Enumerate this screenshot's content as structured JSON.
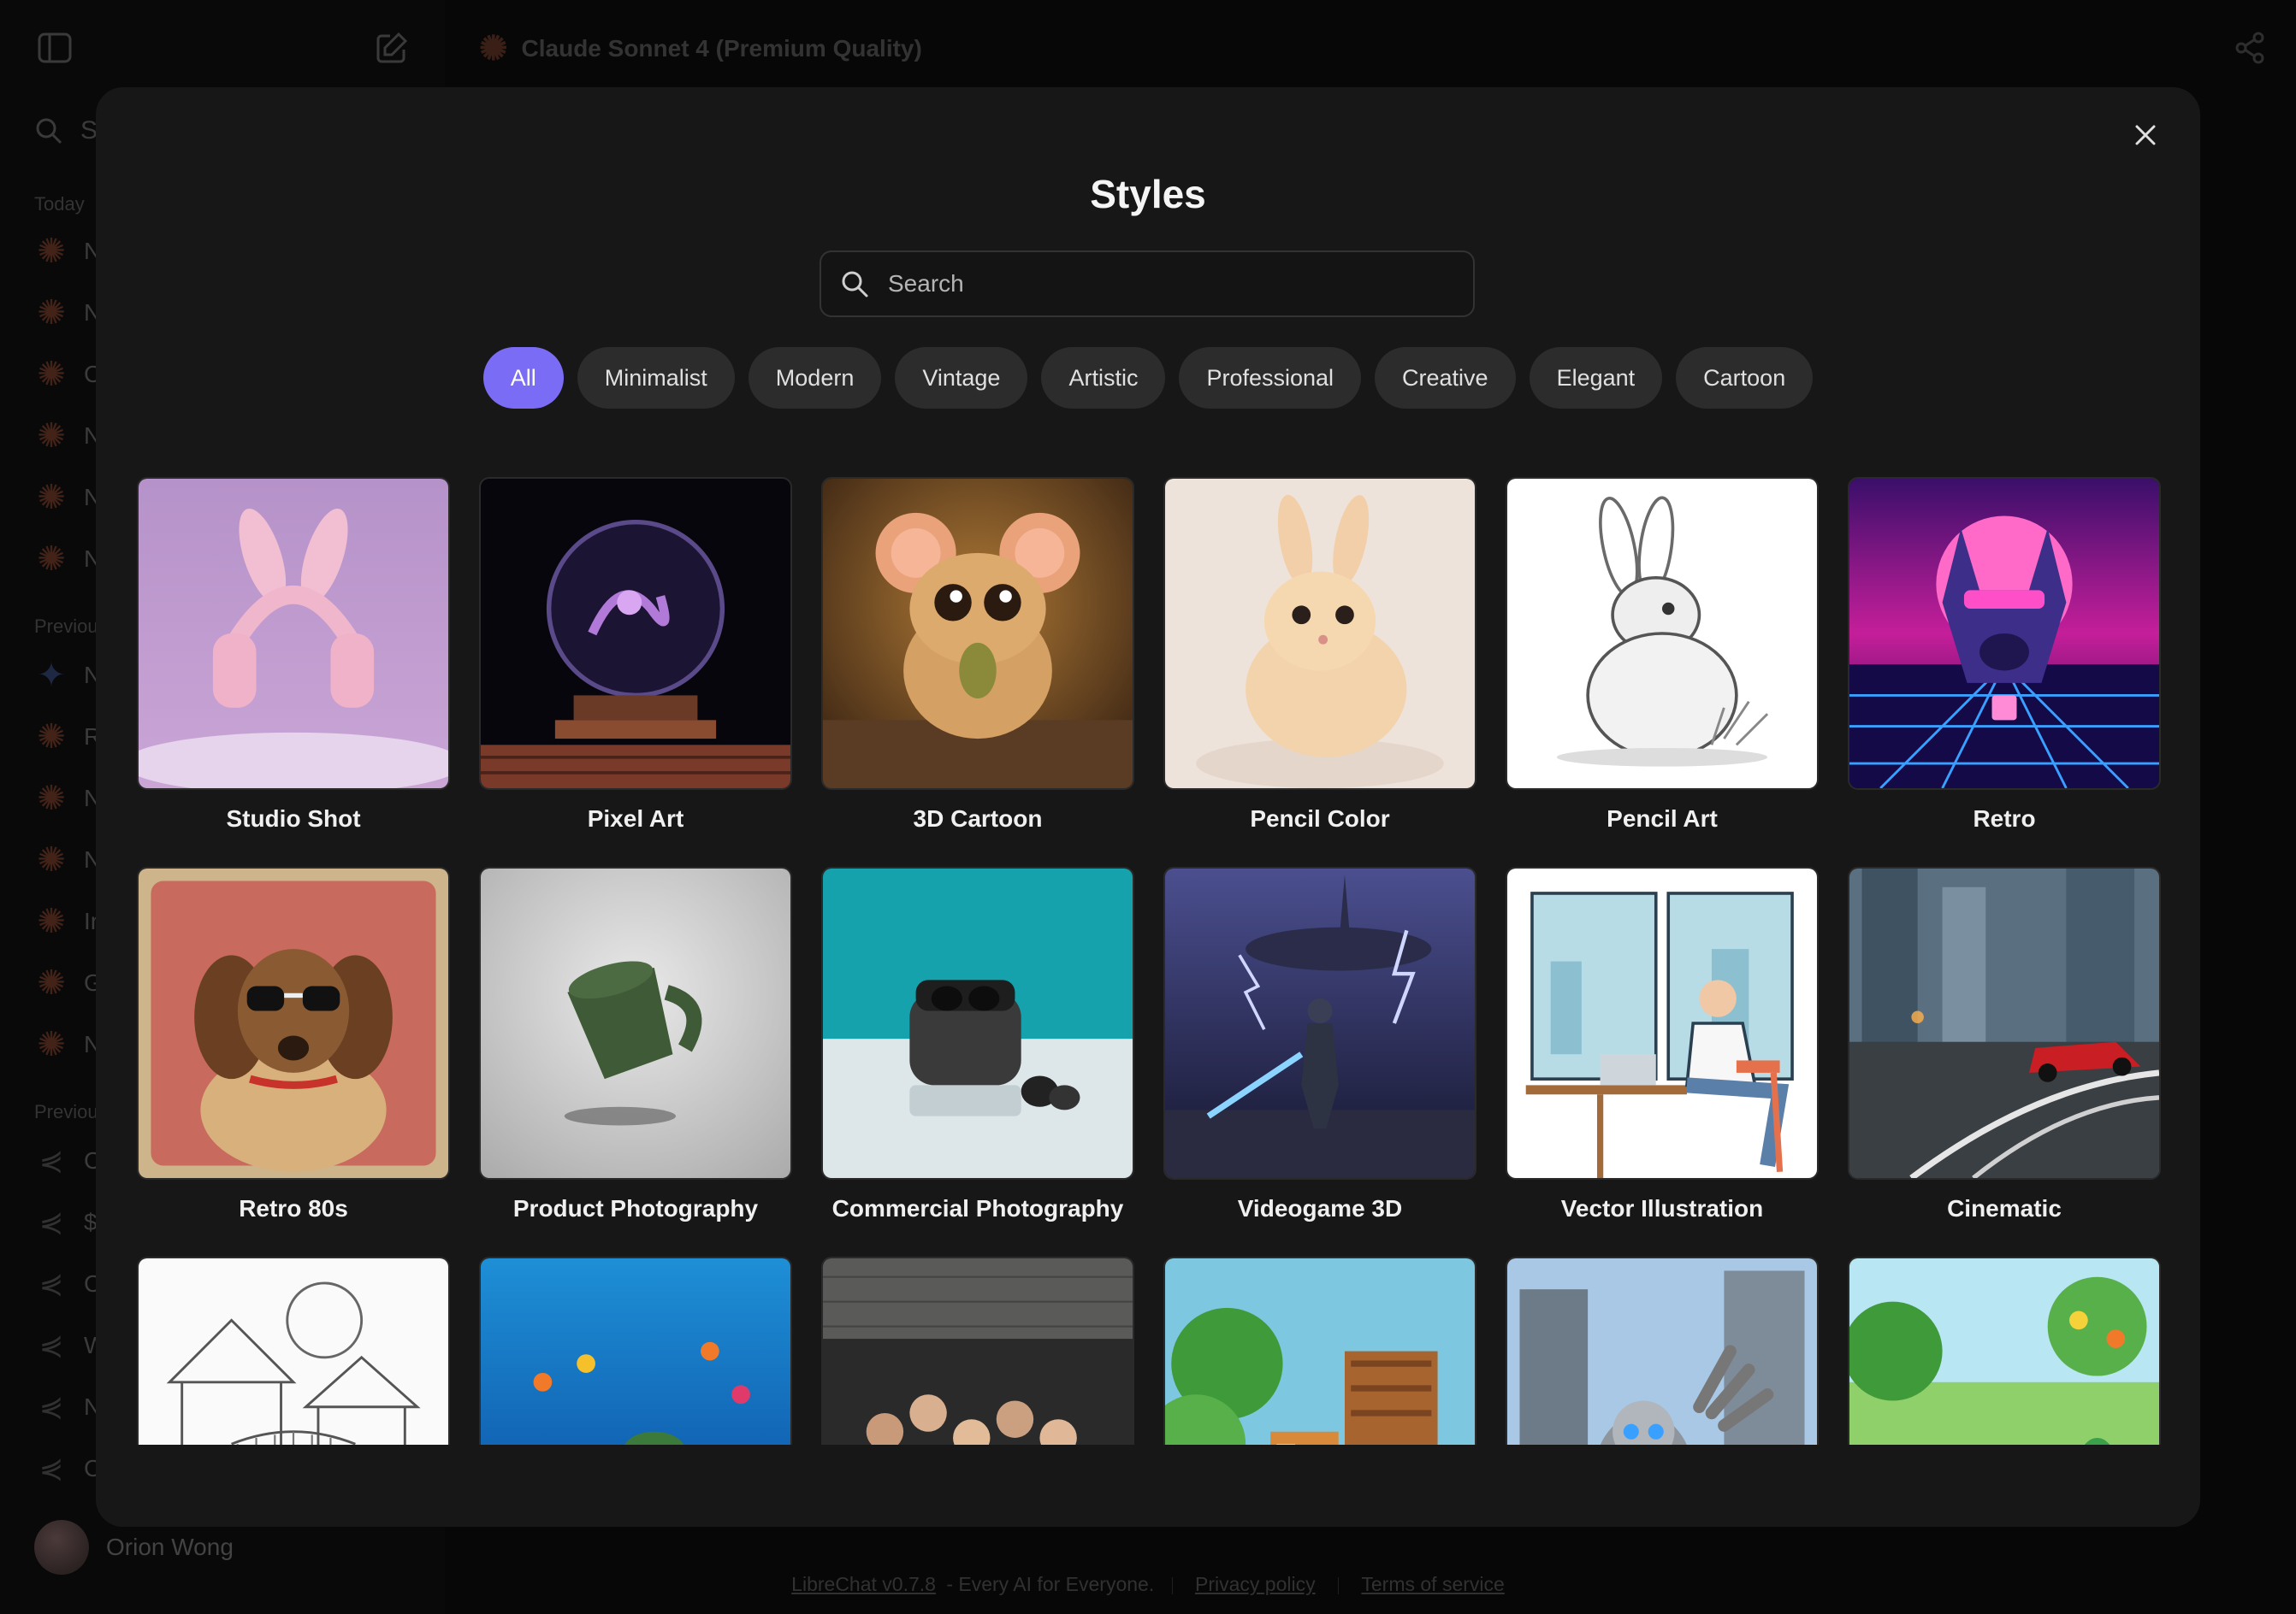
{
  "app": {
    "model_title": "Claude Sonnet 4 (Premium Quality)",
    "sidebar": {
      "search_placeholder": "S",
      "groups": [
        "Today",
        "Previou",
        "Previou"
      ],
      "items": [
        "N",
        "N",
        "C",
        "N",
        "N",
        "N",
        "N",
        "R",
        "N",
        "N",
        "Ir",
        "G",
        "N",
        "C",
        "$",
        "C",
        "W",
        "N",
        "C"
      ]
    },
    "user_name": "Orion Wong",
    "footer": {
      "version_link": "LibreChat v0.7.8",
      "tagline": " - Every AI for Everyone.",
      "privacy": "Privacy policy",
      "terms": "Terms of service"
    }
  },
  "modal": {
    "title": "Styles",
    "search_placeholder": "Search",
    "filters": [
      "All",
      "Minimalist",
      "Modern",
      "Vintage",
      "Artistic",
      "Professional",
      "Creative",
      "Elegant",
      "Cartoon"
    ],
    "active_filter": "All",
    "styles": [
      {
        "label": "Studio Shot",
        "image": "pink-bunny-headphones"
      },
      {
        "label": "Pixel Art",
        "image": "crystal-ball"
      },
      {
        "label": "3D Cartoon",
        "image": "cartoon-mouse"
      },
      {
        "label": "Pencil Color",
        "image": "colored-bunny"
      },
      {
        "label": "Pencil Art",
        "image": "sketched-rabbit"
      },
      {
        "label": "Retro",
        "image": "synthwave-dog"
      },
      {
        "label": "Retro 80s",
        "image": "dog-with-sunglasses"
      },
      {
        "label": "Product Photography",
        "image": "green-mug"
      },
      {
        "label": "Commercial Photography",
        "image": "earbuds-case"
      },
      {
        "label": "Videogame 3D",
        "image": "sci-fi-warrior"
      },
      {
        "label": "Vector Illustration",
        "image": "man-at-laptop"
      },
      {
        "label": "Cinematic",
        "image": "red-sports-car"
      },
      {
        "label": "",
        "image": "coloring-page-treehouse"
      },
      {
        "label": "",
        "image": "underwater-reef"
      },
      {
        "label": "",
        "image": "bowling-group-photo"
      },
      {
        "label": "",
        "image": "pixel-dog-on-porch"
      },
      {
        "label": "",
        "image": "robot-in-city"
      },
      {
        "label": "",
        "image": "clay-animals"
      }
    ],
    "close_icon": "close-icon"
  }
}
